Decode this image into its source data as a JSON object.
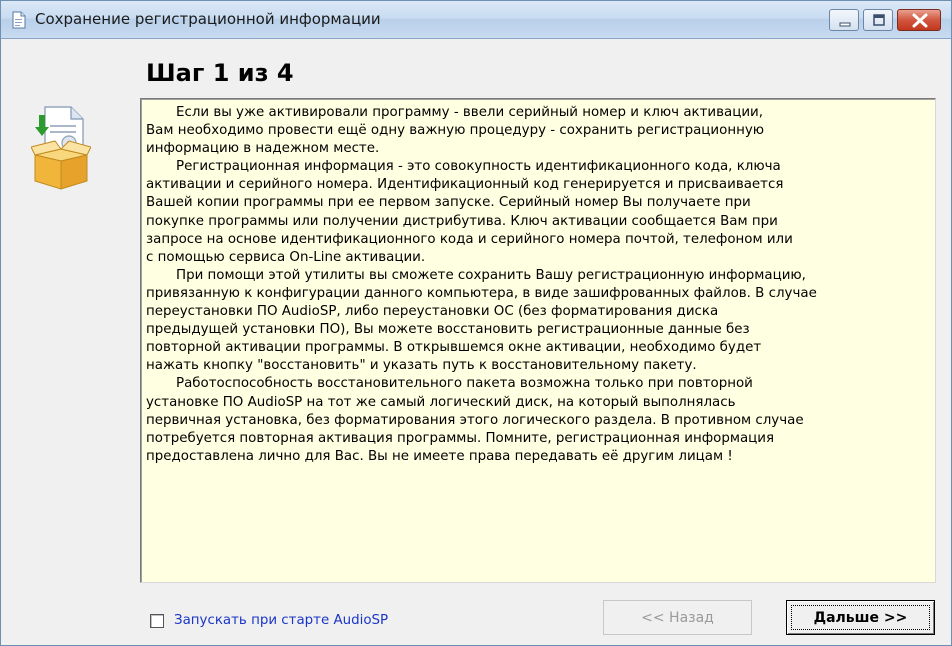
{
  "window": {
    "title": "Сохранение регистрационной информации",
    "icon": "document-icon",
    "controls": [
      "minimize-icon",
      "maximize-icon",
      "close-icon"
    ]
  },
  "wizard": {
    "step_title": "Шаг 1 из 4",
    "illustration": "box-document-download-icon",
    "info_paragraphs": [
      "Если вы уже активировали программу - ввели серийный номер и ключ активации,\nВам необходимо провести ещё одну важную процедуру - сохранить регистрационную\nинформацию в надежном месте.",
      "Регистрационная информация -  это совокупность идентификационного кода, ключа\nактивации и серийного номера. Идентификационный код генерируется и присваивается\nВашей копии программы при ее первом запуске. Серийный номер Вы получаете при\nпокупке программы или получении дистрибутива. Ключ активации сообщается Вам при\nзапросе на основе идентификационного кода и серийного номера почтой, телефоном или\nс помощью сервиса On-Line активации.",
      "При помощи этой утилиты вы сможете сохранить Вашу регистрационную информацию,\nпривязанную к конфигурации данного компьютера, в виде зашифрованных файлов. В случае\nпереустановки ПО AudioSP, либо переустановки ОС (без форматирования диска\nпредыдущей установки ПО), Вы можете восстановить регистрационные данные без\nповторной активации программы. В открывшемся окне активации, необходимо будет\nнажать кнопку \"восстановить\" и указать путь к восстановительному пакету.",
      "Работоспособность восстановительного пакета возможна только при повторной\nустановке ПО AudioSP на тот же самый логический диск, на который выполнялась\nпервичная установка, без форматирования этого логического раздела. В противном случае\nпотребуется повторная активация программы. Помните, регистрационная информация\nпредоставлена лично для Вас. Вы не имеете права передавать её другим лицам !"
    ],
    "autostart": {
      "label": "Запускать при старте AudioSP",
      "checked": false
    },
    "buttons": {
      "back_label": "<< Назад",
      "back_enabled": false,
      "next_label": "Дальше >>"
    }
  },
  "colors": {
    "text_background": "#ffffe1",
    "link_text": "#1a35c8",
    "disabled_text": "#9a9a9a",
    "close_button": "#c1371e"
  }
}
